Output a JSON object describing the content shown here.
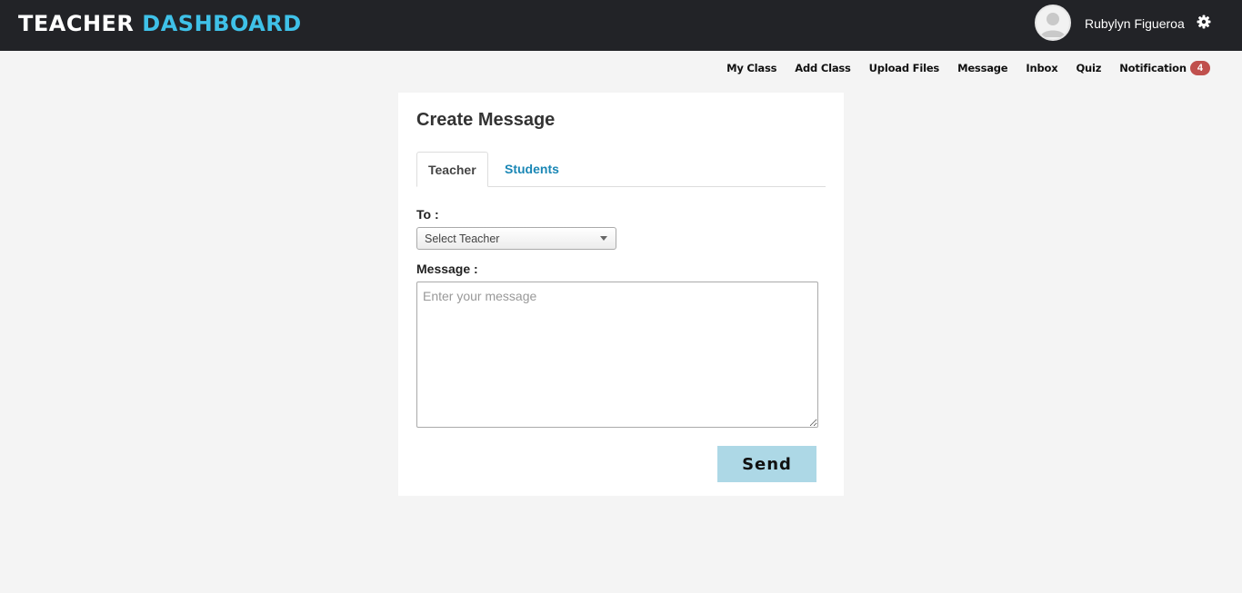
{
  "header": {
    "brand_part1": "TEACHER",
    "brand_part2": "DASHBOARD",
    "user_name": "Rubylyn Figueroa",
    "brand_accent_color": "#3fc1e8",
    "avatar_icon": "user-avatar-icon",
    "settings_icon": "gear-icon"
  },
  "nav": {
    "items": [
      {
        "label": "My Class"
      },
      {
        "label": "Add Class"
      },
      {
        "label": "Upload Files"
      },
      {
        "label": "Message"
      },
      {
        "label": "Inbox"
      },
      {
        "label": "Quiz"
      },
      {
        "label": "Notification"
      }
    ],
    "notification_count": "4"
  },
  "form": {
    "title": "Create Message",
    "tabs": [
      {
        "label": "Teacher",
        "active": true
      },
      {
        "label": "Students",
        "active": false
      }
    ],
    "to_label": "To :",
    "select_value": "Select Teacher",
    "message_label": "Message :",
    "message_placeholder": "Enter your message",
    "send_label": "Send",
    "send_color": "#add8e6"
  }
}
